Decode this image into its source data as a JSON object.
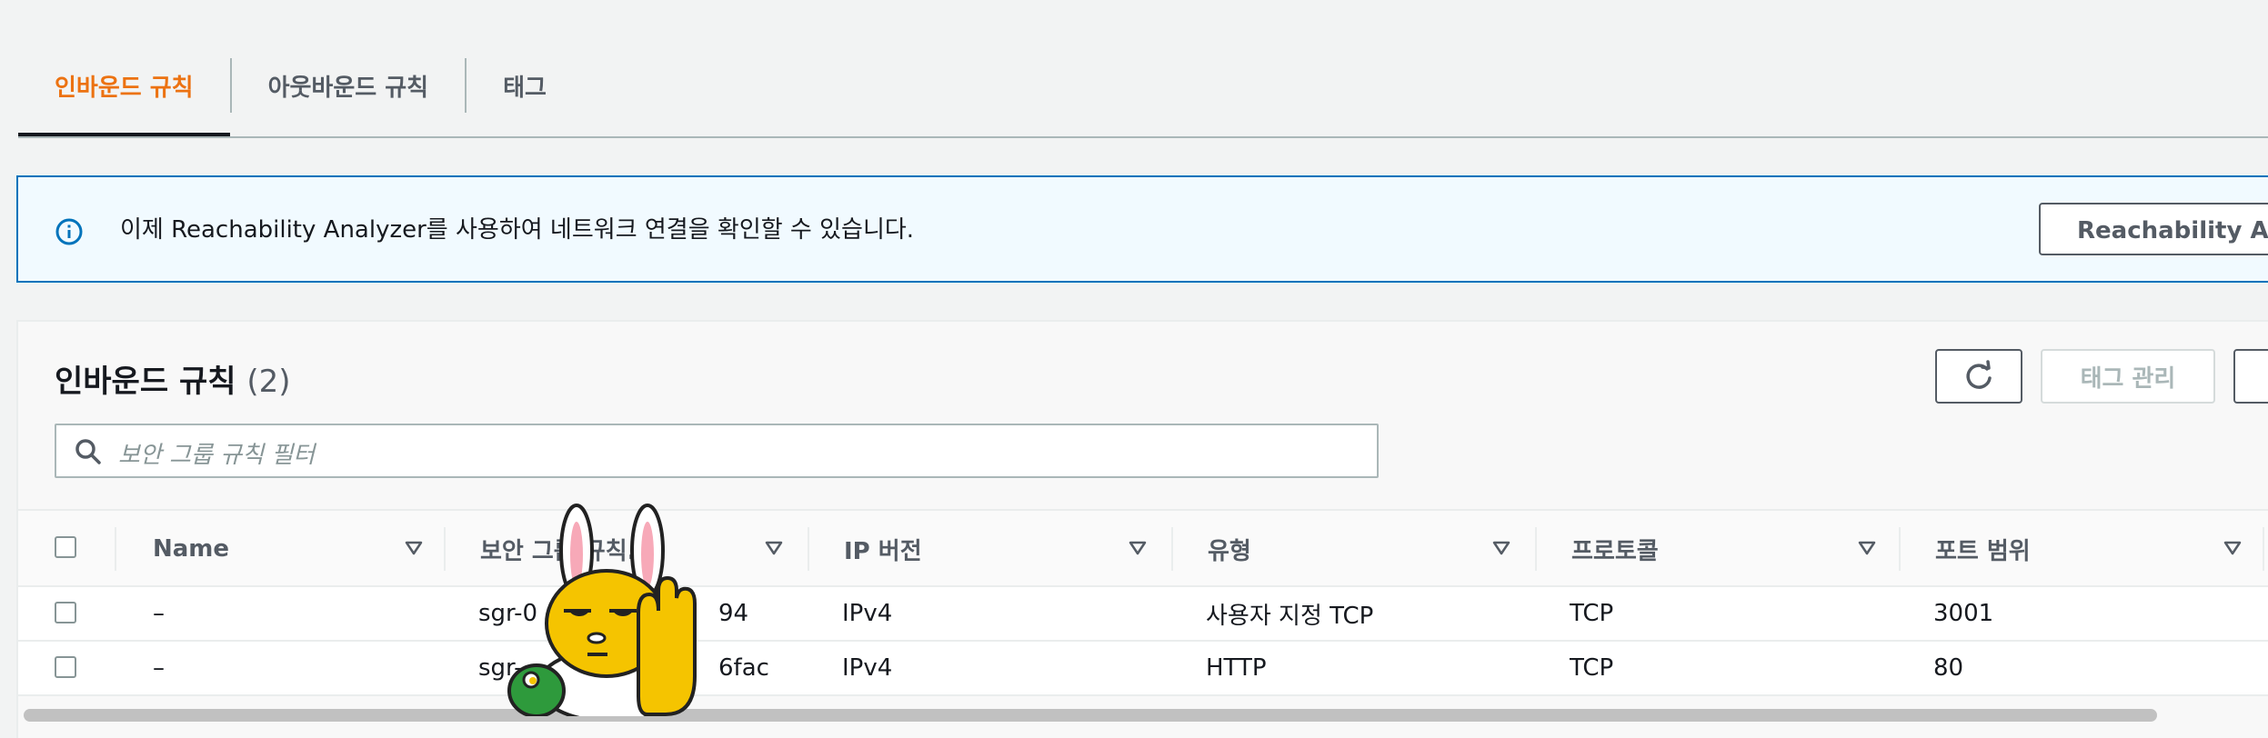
{
  "tabs": [
    {
      "label": "인바운드 규칙",
      "active": true
    },
    {
      "label": "아웃바운드 규칙",
      "active": false
    },
    {
      "label": "태그",
      "active": false
    }
  ],
  "banner": {
    "message": "이제 Reachability Analyzer를 사용하여 네트워크 연결을 확인할 수 있습니다.",
    "button_label": "Reachability Analyzer"
  },
  "panel": {
    "title": "인바운드 규칙",
    "count": "(2)",
    "tag_button": "태그 관리",
    "search_placeholder": "보안 그룹 규칙 필터"
  },
  "table": {
    "columns": [
      "Name",
      "보안 그룹 규칙...",
      "IP 버전",
      "유형",
      "프로토콜",
      "포트 범위"
    ],
    "rows": [
      {
        "name": "–",
        "rule_id": "sgr-0",
        "rule_id_tail": "94",
        "ip_version": "IPv4",
        "type": "사용자 지정 TCP",
        "protocol": "TCP",
        "port_range": "3001"
      },
      {
        "name": "–",
        "rule_id": "sgr-",
        "rule_id_tail": "6fac",
        "ip_version": "IPv4",
        "type": "HTTP",
        "protocol": "TCP",
        "port_range": "80"
      }
    ]
  },
  "colors": {
    "accent": "#ec7211",
    "info": "#0073bb",
    "text": "#16191f",
    "muted": "#545b64"
  }
}
